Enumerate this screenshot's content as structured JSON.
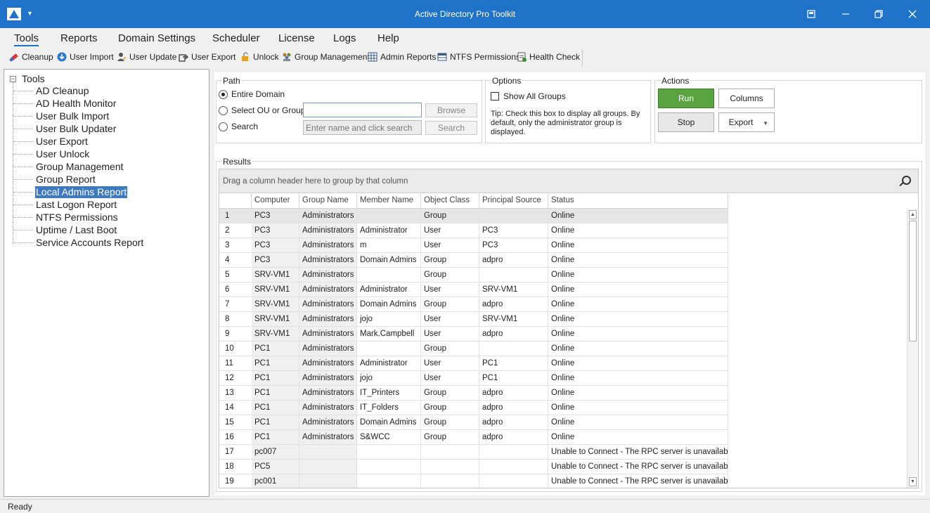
{
  "window": {
    "title": "Active Directory Pro Toolkit"
  },
  "menu": [
    "Tools",
    "Reports",
    "Domain Settings",
    "Scheduler",
    "License",
    "Logs",
    "Help"
  ],
  "toolbar": [
    {
      "label": "Cleanup",
      "icon": "eraser-icon",
      "color": "#d9343a"
    },
    {
      "label": "User Import",
      "icon": "download-icon",
      "color": "#2a78d0"
    },
    {
      "label": "User Update",
      "icon": "user-edit-icon",
      "color": "#5b5b5b"
    },
    {
      "label": "User Export",
      "icon": "export-icon",
      "color": "#444444"
    },
    {
      "label": "Unlock",
      "icon": "unlock-icon",
      "color": "#e8a020"
    },
    {
      "label": "Group Management",
      "icon": "group-icon",
      "color": "#b07830"
    },
    {
      "label": "Admin Reports",
      "icon": "grid-icon",
      "color": "#3a5a8a"
    },
    {
      "label": "NTFS Permissions",
      "icon": "table-icon",
      "color": "#3a5a8a"
    },
    {
      "label": "Health Check",
      "icon": "checklist-icon",
      "color": "#3a8a3a"
    }
  ],
  "tree": {
    "root": "Tools",
    "items": [
      "AD Cleanup",
      "AD Health Monitor",
      "User Bulk Import",
      "User Bulk Updater",
      "User Export",
      "User Unlock",
      "Group Management",
      "Group Report",
      "Local Admins Report",
      "Last Logon Report",
      "NTFS Permissions",
      "Uptime / Last Boot",
      "Service Accounts Report"
    ],
    "selected": "Local Admins Report"
  },
  "path": {
    "label": "Path",
    "entire_domain": "Entire Domain",
    "select_ou": "Select OU or Group",
    "search": "Search",
    "ou_value": "",
    "search_placeholder": "Enter name and click search",
    "browse": "Browse",
    "search_btn": "Search"
  },
  "options": {
    "label": "Options",
    "show_all": "Show All Groups",
    "tip": "Tip: Check this box to display all groups. By default, only the administrator group is displayed."
  },
  "actions": {
    "label": "Actions",
    "run": "Run",
    "columns": "Columns",
    "stop": "Stop",
    "export": "Export"
  },
  "results": {
    "label": "Results",
    "group_hint": "Drag a column header here to group by that column",
    "columns": [
      "Computer",
      "Group Name",
      "Member Name",
      "Object Class",
      "Principal Source",
      "Status"
    ],
    "rows": [
      [
        "1",
        "PC3",
        "Administrators",
        "",
        "Group",
        "",
        "Online"
      ],
      [
        "2",
        "PC3",
        "Administrators",
        "Administrator",
        "User",
        "PC3",
        "Online"
      ],
      [
        "3",
        "PC3",
        "Administrators",
        "m",
        "User",
        "PC3",
        "Online"
      ],
      [
        "4",
        "PC3",
        "Administrators",
        "Domain Admins",
        "Group",
        "adpro",
        "Online"
      ],
      [
        "5",
        "SRV-VM1",
        "Administrators",
        "",
        "Group",
        "",
        "Online"
      ],
      [
        "6",
        "SRV-VM1",
        "Administrators",
        "Administrator",
        "User",
        "SRV-VM1",
        "Online"
      ],
      [
        "7",
        "SRV-VM1",
        "Administrators",
        "Domain Admins",
        "Group",
        "adpro",
        "Online"
      ],
      [
        "8",
        "SRV-VM1",
        "Administrators",
        "jojo",
        "User",
        "SRV-VM1",
        "Online"
      ],
      [
        "9",
        "SRV-VM1",
        "Administrators",
        "Mark.Campbell",
        "User",
        "adpro",
        "Online"
      ],
      [
        "10",
        "PC1",
        "Administrators",
        "",
        "Group",
        "",
        "Online"
      ],
      [
        "11",
        "PC1",
        "Administrators",
        "Administrator",
        "User",
        "PC1",
        "Online"
      ],
      [
        "12",
        "PC1",
        "Administrators",
        "jojo",
        "User",
        "PC1",
        "Online"
      ],
      [
        "13",
        "PC1",
        "Administrators",
        "IT_Printers",
        "Group",
        "adpro",
        "Online"
      ],
      [
        "14",
        "PC1",
        "Administrators",
        "IT_Folders",
        "Group",
        "adpro",
        "Online"
      ],
      [
        "15",
        "PC1",
        "Administrators",
        "Domain Admins",
        "Group",
        "adpro",
        "Online"
      ],
      [
        "16",
        "PC1",
        "Administrators",
        "S&WCC",
        "Group",
        "adpro",
        "Online"
      ],
      [
        "17",
        "pc007",
        "",
        "",
        "",
        "",
        "Unable to Connect - The RPC server is unavailable."
      ],
      [
        "18",
        "PC5",
        "",
        "",
        "",
        "",
        "Unable to Connect - The RPC server is unavailable."
      ],
      [
        "19",
        "pc001",
        "",
        "",
        "",
        "",
        "Unable to Connect - The RPC server is unavailable."
      ]
    ]
  },
  "status": {
    "text": "Ready"
  }
}
